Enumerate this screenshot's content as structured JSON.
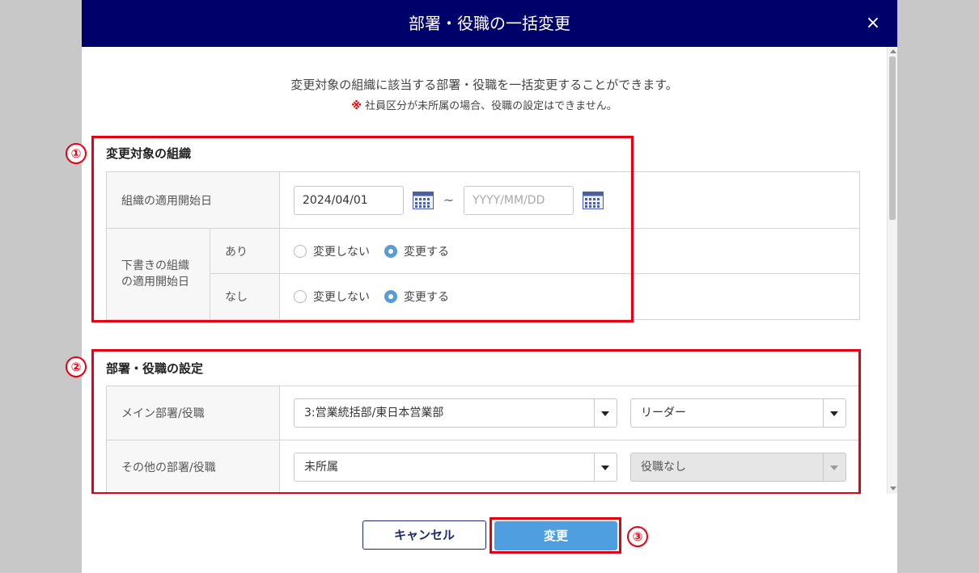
{
  "dialog": {
    "title": "部署・役職の一括変更",
    "close_glyph": "×",
    "description_line1": "変更対象の組織に該当する部署・役職を一括変更することができます。",
    "note_mark": "※",
    "note_text": "社員区分が未所属の場合、役職の設定はできません。"
  },
  "section1": {
    "number": "①",
    "title": "変更対象の組織",
    "start_date_label": "組織の適用開始日",
    "start_date_from": "2024/04/01",
    "start_date_to_placeholder": "YYYY/MM/DD",
    "range_separator": "~",
    "draft_label_line1": "下書きの組織",
    "draft_label_line2": "の適用開始日",
    "rows": [
      {
        "label": "あり",
        "option_no_change": "変更しない",
        "option_change": "変更する",
        "selected": "change"
      },
      {
        "label": "なし",
        "option_no_change": "変更しない",
        "option_change": "変更する",
        "selected": "change"
      }
    ]
  },
  "section2": {
    "number": "②",
    "title": "部署・役職の設定",
    "main_label": "メイン部署/役職",
    "main_department": "3:営業統括部/東日本営業部",
    "main_position": "リーダー",
    "other_label": "その他の部署/役職",
    "other_department": "未所属",
    "other_position": "役職なし"
  },
  "footer": {
    "cancel_label": "キャンセル",
    "change_label": "変更",
    "change_number": "③"
  },
  "colors": {
    "header_bg": "#00006a",
    "highlight": "#e50012",
    "primary_button": "#4f9fe0",
    "radio_selected": "#5b9bd5"
  }
}
